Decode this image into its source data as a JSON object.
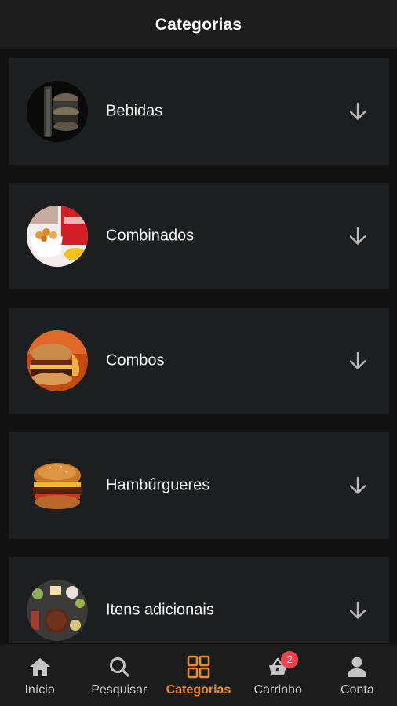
{
  "header": {
    "title": "Categorias"
  },
  "categories": [
    {
      "label": "Bebidas"
    },
    {
      "label": "Combinados"
    },
    {
      "label": "Combos"
    },
    {
      "label": "Hambúrgueres"
    },
    {
      "label": "Itens adicionais"
    }
  ],
  "bottom_nav": {
    "items": [
      {
        "label": "Início",
        "icon": "home-icon"
      },
      {
        "label": "Pesquisar",
        "icon": "search-icon"
      },
      {
        "label": "Categorias",
        "icon": "grid-icon",
        "active": true
      },
      {
        "label": "Carrinho",
        "icon": "basket-icon",
        "badge": "2"
      },
      {
        "label": "Conta",
        "icon": "user-icon"
      }
    ]
  },
  "colors": {
    "background": "#121212",
    "card": "#1d1e20",
    "header": "#1c1c1c",
    "accent": "#e8892a",
    "badge": "#f0414d",
    "text": "#ffffff",
    "muted": "#c4c4c4"
  }
}
